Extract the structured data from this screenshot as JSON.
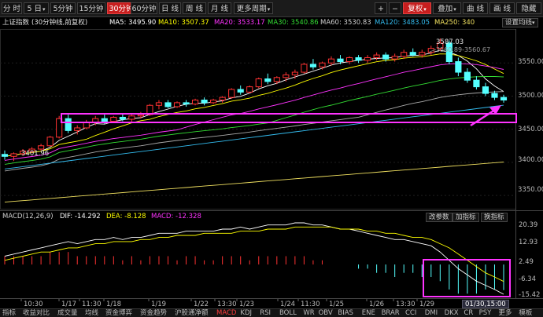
{
  "toolbar": {
    "left": [
      "分 时",
      "5 日",
      "5分钟",
      "15分钟",
      "30分钟",
      "60分钟",
      "日 线",
      "周 线",
      "月 线",
      "更多周期"
    ],
    "active_index": 4,
    "right": [
      "+",
      "−",
      "复权",
      "叠加",
      "曲 线",
      "画 线",
      "隐藏"
    ]
  },
  "info": {
    "title": "上证指数",
    "subtitle": "(30分钟线,前复权)",
    "ma5": "MA5: 3495.90",
    "ma10": "MA10: 3507.37",
    "ma20": "MA20: 3533.17",
    "ma30": "MA30: 3540.86",
    "ma60": "MA60: 3530.83",
    "ma120": "MA120: 3483.05",
    "ma250": "MA250: 340",
    "setting": "设置均线"
  },
  "price_axis": [
    "3550.00",
    "3500.00",
    "3450.00",
    "3400.00",
    "3350.00"
  ],
  "annotations": {
    "high": "3587.03",
    "low": "3401.96",
    "pointer": "3560.89-3560.67"
  },
  "macd_info": {
    "name": "MACD(12,26,9)",
    "dif": "DIF: -14.292",
    "dea": "DEA: -8.128",
    "macd": "MACD: -12.328"
  },
  "macd_axis": [
    "20.39",
    "12.93",
    "2.49",
    "-6.34",
    "-15.42"
  ],
  "sub_buttons": [
    "改参数",
    "加指标",
    "换指标"
  ],
  "time_axis": [
    "10:30",
    "1/17",
    "11:30",
    "1/18",
    "1/19",
    "1/22",
    "13:30",
    "1/23",
    "1/24",
    "11:30",
    "1/25",
    "1/26",
    "13:30",
    "1/29"
  ],
  "time_badge": "01/30,15:00",
  "bottom_tabs": [
    "指标",
    "收益对比",
    "成交量",
    "均线",
    "资金博弈",
    "资金趋势",
    "沪股通净额",
    "MACD",
    "KDJ",
    "RSI",
    "BOLL",
    "WR",
    "OBV",
    "BIAS",
    "ENE",
    "BRAR",
    "CCI",
    "DMI",
    "DKX",
    "CR",
    "PSY",
    "更多",
    "模板"
  ],
  "bottom_active_index": 7,
  "colors": {
    "up": "#ff3232",
    "down": "#54ffff",
    "ma5": "#ffffff",
    "ma10": "#ffff00",
    "ma20": "#ff33ff",
    "ma30": "#33dd33",
    "ma60": "#aaaaaa",
    "ma120": "#33bbee",
    "ma250": "#f0e060",
    "highlight": "#ff33ff"
  },
  "chart_data": {
    "type": "candlestick",
    "price_range": [
      3330,
      3600
    ],
    "macd_range": [
      -15.42,
      20.39
    ],
    "candles": [
      [
        3412,
        3418,
        3404,
        3409
      ],
      [
        3409,
        3415,
        3402,
        3413
      ],
      [
        3413,
        3420,
        3410,
        3417
      ],
      [
        3417,
        3423,
        3414,
        3420
      ],
      [
        3420,
        3428,
        3418,
        3425
      ],
      [
        3425,
        3440,
        3424,
        3438
      ],
      [
        3438,
        3470,
        3436,
        3466
      ],
      [
        3466,
        3472,
        3444,
        3448
      ],
      [
        3448,
        3456,
        3442,
        3452
      ],
      [
        3452,
        3464,
        3450,
        3460
      ],
      [
        3460,
        3470,
        3456,
        3466
      ],
      [
        3466,
        3472,
        3458,
        3462
      ],
      [
        3462,
        3470,
        3460,
        3468
      ],
      [
        3468,
        3474,
        3462,
        3465
      ],
      [
        3465,
        3472,
        3461,
        3470
      ],
      [
        3470,
        3476,
        3466,
        3472
      ],
      [
        3472,
        3488,
        3470,
        3486
      ],
      [
        3486,
        3494,
        3480,
        3490
      ],
      [
        3490,
        3494,
        3482,
        3484
      ],
      [
        3484,
        3492,
        3482,
        3490
      ],
      [
        3490,
        3494,
        3484,
        3488
      ],
      [
        3488,
        3496,
        3486,
        3494
      ],
      [
        3494,
        3498,
        3486,
        3490
      ],
      [
        3490,
        3496,
        3488,
        3494
      ],
      [
        3494,
        3500,
        3490,
        3498
      ],
      [
        3498,
        3512,
        3496,
        3510
      ],
      [
        3510,
        3516,
        3502,
        3506
      ],
      [
        3506,
        3516,
        3504,
        3514
      ],
      [
        3514,
        3528,
        3512,
        3526
      ],
      [
        3526,
        3534,
        3518,
        3522
      ],
      [
        3522,
        3530,
        3518,
        3528
      ],
      [
        3528,
        3536,
        3522,
        3532
      ],
      [
        3532,
        3540,
        3526,
        3536
      ],
      [
        3536,
        3550,
        3534,
        3548
      ],
      [
        3548,
        3556,
        3540,
        3544
      ],
      [
        3544,
        3552,
        3540,
        3550
      ],
      [
        3550,
        3560,
        3546,
        3556
      ],
      [
        3556,
        3562,
        3548,
        3552
      ],
      [
        3552,
        3560,
        3548,
        3558
      ],
      [
        3558,
        3562,
        3550,
        3554
      ],
      [
        3554,
        3562,
        3550,
        3558
      ],
      [
        3558,
        3566,
        3554,
        3562
      ],
      [
        3562,
        3566,
        3552,
        3556
      ],
      [
        3556,
        3564,
        3552,
        3560
      ],
      [
        3560,
        3570,
        3556,
        3566
      ],
      [
        3566,
        3572,
        3560,
        3562
      ],
      [
        3562,
        3570,
        3558,
        3566
      ],
      [
        3566,
        3576,
        3562,
        3572
      ],
      [
        3572,
        3587,
        3568,
        3580
      ],
      [
        3580,
        3584,
        3548,
        3552
      ],
      [
        3552,
        3558,
        3530,
        3536
      ],
      [
        3536,
        3542,
        3520,
        3524
      ],
      [
        3524,
        3530,
        3510,
        3514
      ],
      [
        3514,
        3520,
        3500,
        3504
      ],
      [
        3504,
        3508,
        3494,
        3498
      ],
      [
        3498,
        3502,
        3490,
        3494
      ]
    ],
    "macd_dif": [
      4,
      5,
      6,
      7,
      8,
      9,
      10,
      11,
      10,
      11,
      12,
      12,
      13,
      12,
      13,
      13,
      14,
      15,
      15,
      15,
      16,
      16,
      16,
      16,
      17,
      17,
      18,
      17,
      18,
      19,
      19,
      19,
      20,
      20,
      19,
      19,
      18,
      17,
      17,
      16,
      15,
      14,
      13,
      12,
      12,
      11,
      10,
      9,
      6,
      2,
      -2,
      -5,
      -8,
      -10,
      -12,
      -14.292
    ],
    "macd_dea": [
      2,
      3,
      4,
      5,
      6,
      6,
      7,
      8,
      8,
      9,
      10,
      10,
      11,
      11,
      11,
      12,
      12,
      13,
      13,
      14,
      14,
      14,
      15,
      15,
      15,
      15,
      16,
      16,
      16,
      17,
      17,
      17,
      18,
      18,
      18,
      18,
      18,
      17,
      17,
      17,
      16,
      16,
      15,
      15,
      14,
      13,
      13,
      12,
      10,
      8,
      5,
      2,
      -1,
      -4,
      -6,
      -8.128
    ],
    "macd_hist": [
      4,
      4,
      4,
      4,
      4,
      6,
      6,
      6,
      4,
      4,
      4,
      4,
      4,
      2,
      4,
      2,
      4,
      4,
      4,
      2,
      4,
      4,
      2,
      2,
      4,
      4,
      4,
      2,
      4,
      4,
      4,
      4,
      4,
      4,
      2,
      2,
      0,
      0,
      0,
      -2,
      -2,
      -4,
      -4,
      -6,
      -4,
      -4,
      -6,
      -6,
      -8,
      -12,
      -14,
      -14,
      -14,
      -12,
      -12,
      -12.328
    ]
  }
}
